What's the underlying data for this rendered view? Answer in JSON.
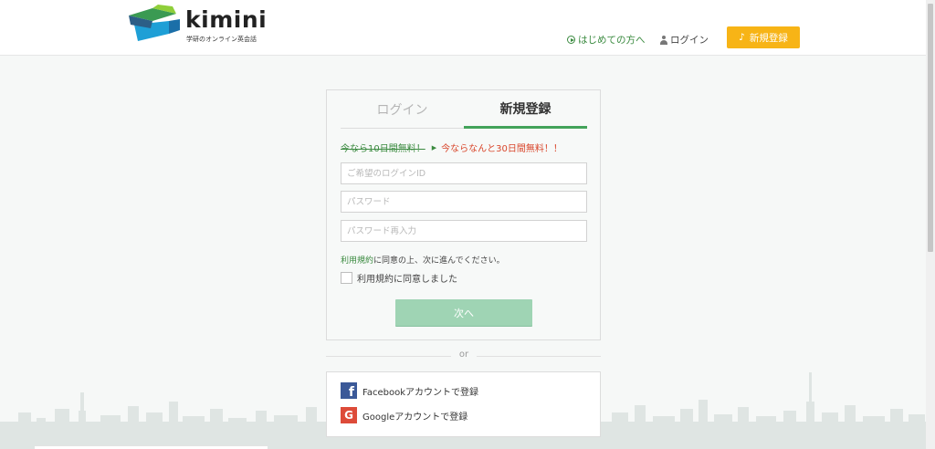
{
  "header": {
    "logo_name": "kimini",
    "logo_tagline": "学研のオンライン英会話",
    "nav_first_time": "はじめての方へ",
    "nav_login": "ログイン",
    "signup_button": "新規登録",
    "icons": {
      "first_time": "play-circle-icon",
      "login": "person-icon",
      "signup": "music-note-icon"
    }
  },
  "form": {
    "tabs": [
      {
        "label": "ログイン",
        "active": false
      },
      {
        "label": "新規登録",
        "active": true
      }
    ],
    "promo_old": "今なら10日間無料！",
    "promo_new": "今ならなんと30日間無料！！",
    "fields": {
      "login_id_placeholder": "ご希望のログインID",
      "password_placeholder": "パスワード",
      "password_confirm_placeholder": "パスワード再入力"
    },
    "terms_link": "利用規約",
    "terms_note_rest": "に同意の上、次に進んでください。",
    "agree_label": "利用規約に同意しました",
    "agree_checked": false,
    "next_button": "次へ"
  },
  "divider_text": "or",
  "social": {
    "facebook": "Facebookアカウントで登録",
    "google": "Googleアカウントで登録"
  },
  "colors": {
    "accent_green": "#43a35a",
    "signup_yellow": "#f7b416",
    "promo_red": "#d9462b",
    "next_button": "#9fd4b4",
    "facebook": "#3b5998",
    "google": "#dd4b39"
  }
}
